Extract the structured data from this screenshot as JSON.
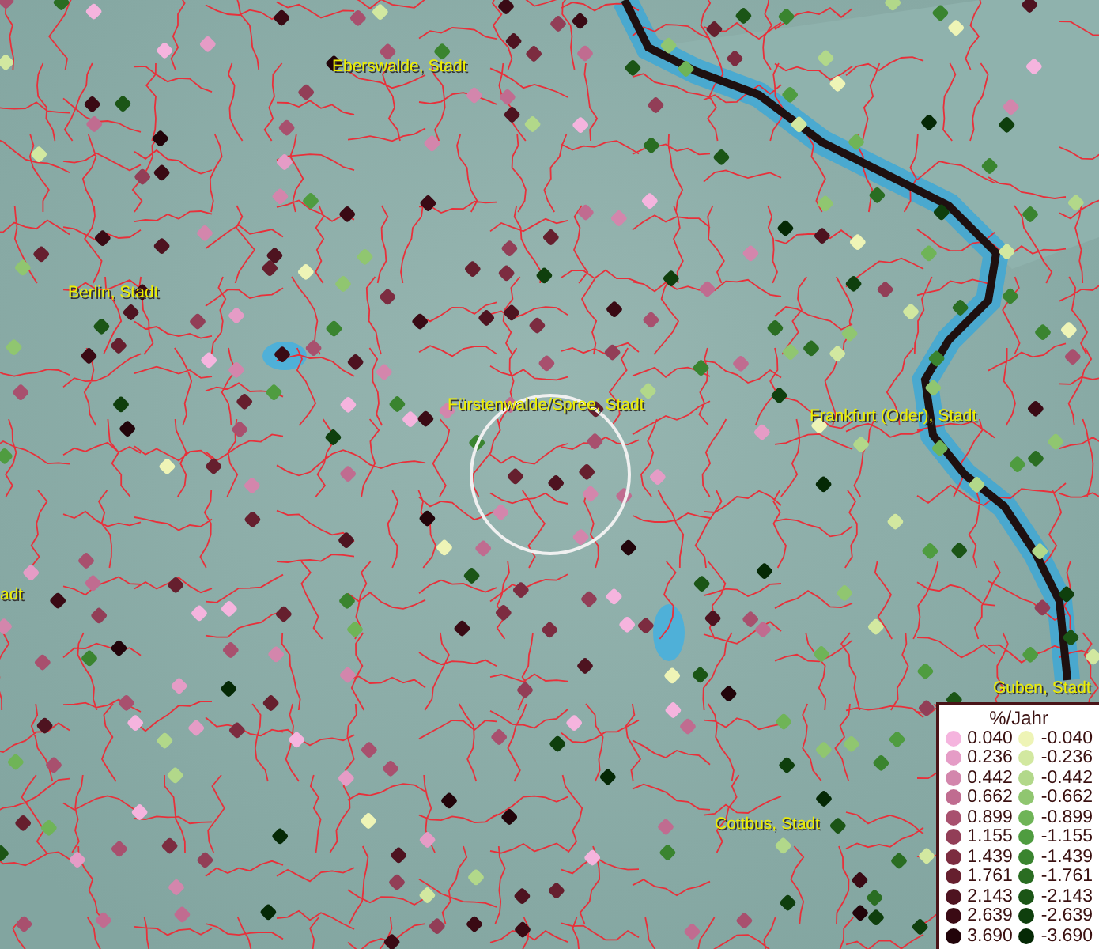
{
  "map": {
    "places": [
      {
        "kind": "city",
        "label": "Eberswalde, Stadt"
      },
      {
        "kind": "city",
        "label": "Berlin, Stadt"
      },
      {
        "kind": "city",
        "label": "Fürstenwalde/Spree, Stadt"
      },
      {
        "kind": "city",
        "label": "Frankfurt (Oder), Stadt"
      },
      {
        "kind": "city",
        "label": "adt"
      },
      {
        "kind": "city",
        "label": "Guben, Stadt"
      },
      {
        "kind": "city",
        "label": "Cottbus, Stadt"
      }
    ]
  },
  "legend": {
    "title": "%/Jahr",
    "positive": [
      {
        "label": "0.040",
        "color": "#f5b4de"
      },
      {
        "label": "0.236",
        "color": "#e59cc6"
      },
      {
        "label": "0.442",
        "color": "#d386ac"
      },
      {
        "label": "0.662",
        "color": "#c06c90"
      },
      {
        "label": "0.899",
        "color": "#a8506e"
      },
      {
        "label": "1.155",
        "color": "#923e57"
      },
      {
        "label": "1.439",
        "color": "#7c2c40"
      },
      {
        "label": "1.761",
        "color": "#661f2e"
      },
      {
        "label": "2.143",
        "color": "#4e1320"
      },
      {
        "label": "2.639",
        "color": "#3a0a14"
      },
      {
        "label": "3.690",
        "color": "#22040a"
      }
    ],
    "negative": [
      {
        "label": "-0.040",
        "color": "#eef4b6"
      },
      {
        "label": "-0.236",
        "color": "#d2e8a0"
      },
      {
        "label": "-0.442",
        "color": "#b2d88a"
      },
      {
        "label": "-0.662",
        "color": "#90c670"
      },
      {
        "label": "-0.899",
        "color": "#6fb457"
      },
      {
        "label": "-1.155",
        "color": "#4f9c40"
      },
      {
        "label": "-1.439",
        "color": "#3a842f"
      },
      {
        "label": "-1.761",
        "color": "#2a6d22"
      },
      {
        "label": "-2.143",
        "color": "#1b5516"
      },
      {
        "label": "-2.639",
        "color": "#0f3f0d"
      },
      {
        "label": "-3.690",
        "color": "#052905"
      }
    ]
  }
}
